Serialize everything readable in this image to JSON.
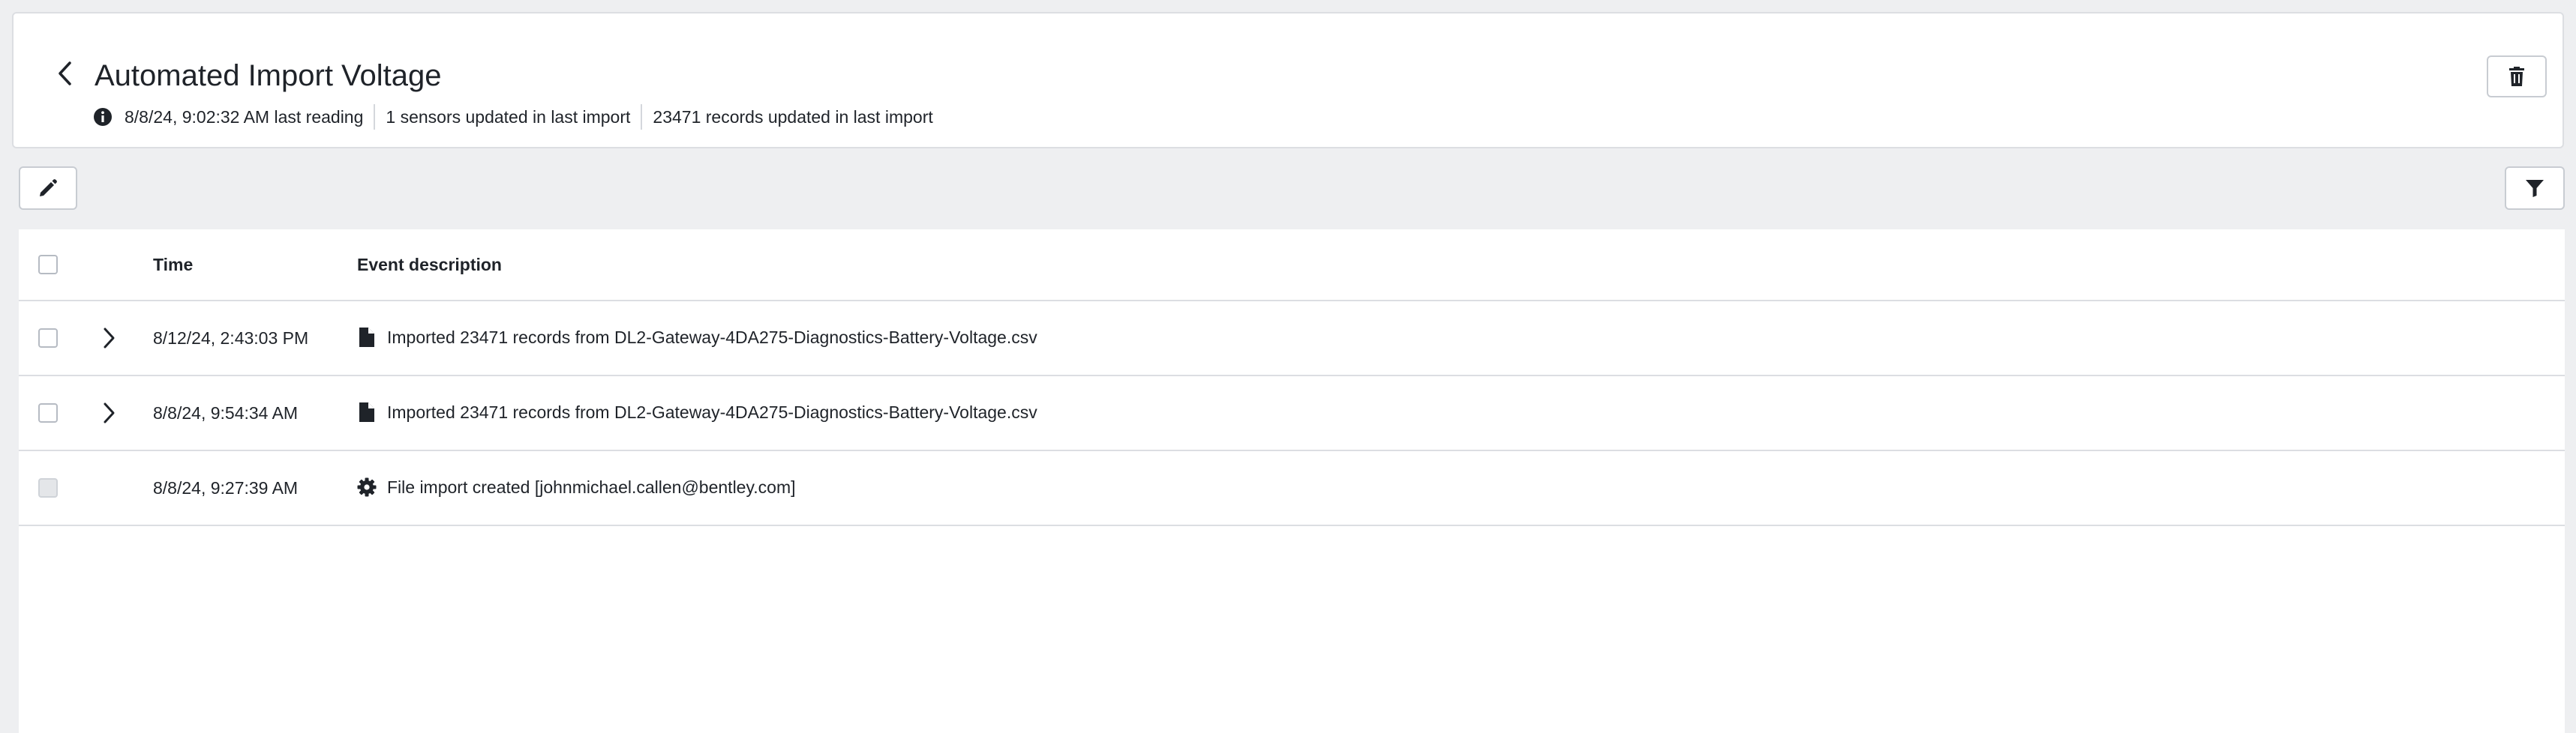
{
  "header": {
    "title": "Automated Import Voltage",
    "last_reading": "8/8/24, 9:02:32 AM last reading",
    "sensors_updated": "1 sensors updated in last import",
    "records_updated": "23471 records updated in last import"
  },
  "table": {
    "columns": {
      "time": "Time",
      "description": "Event description"
    },
    "rows": [
      {
        "time": "8/12/24, 2:43:03 PM",
        "description": "Imported 23471 records from DL2-Gateway-4DA275-Diagnostics-Battery-Voltage.csv",
        "icon": "file-icon",
        "expandable": true
      },
      {
        "time": "8/8/24, 9:54:34 AM",
        "description": "Imported 23471 records from DL2-Gateway-4DA275-Diagnostics-Battery-Voltage.csv",
        "icon": "file-icon",
        "expandable": true
      },
      {
        "time": "8/8/24, 9:27:39 AM",
        "description": "File import created [johnmichael.callen@bentley.com]",
        "icon": "gear-icon",
        "expandable": false
      }
    ]
  },
  "colors": {
    "page_background": "#eeeff1",
    "card_background": "#ffffff",
    "border": "#dcdee2",
    "text": "#1f2329"
  }
}
